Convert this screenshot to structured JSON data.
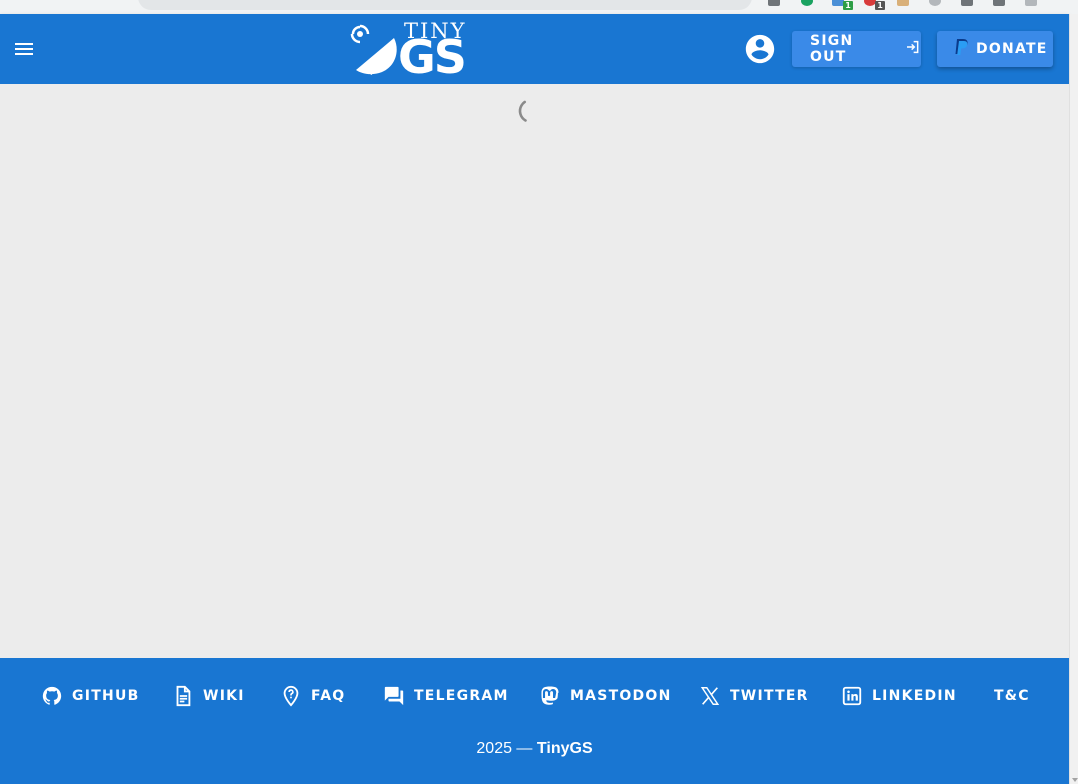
{
  "app": {
    "logo_small": "TINY",
    "logo_large": "GS"
  },
  "header": {
    "menu_icon": "menu-icon",
    "account_icon": "account-circle-icon",
    "sign_out_label": "SIGN OUT",
    "sign_out_icon": "sign-out-icon",
    "donate_label": "DONATE",
    "donate_icon": "paypal-icon"
  },
  "main": {
    "loading_icon": "loading-spinner-icon"
  },
  "footer": {
    "links": [
      {
        "label": "GITHUB",
        "icon": "github-icon"
      },
      {
        "label": "WIKI",
        "icon": "document-icon"
      },
      {
        "label": "FAQ",
        "icon": "help-marker-icon"
      },
      {
        "label": "TELEGRAM",
        "icon": "chat-icon"
      },
      {
        "label": "MASTODON",
        "icon": "mastodon-icon"
      },
      {
        "label": "TWITTER",
        "icon": "x-twitter-icon"
      },
      {
        "label": "LINKEDIN",
        "icon": "linkedin-icon"
      },
      {
        "label": "T&C",
        "icon": ""
      }
    ],
    "copyright_prefix": "2025 —",
    "copyright_brand": "TinyGS"
  },
  "browser": {
    "extension_badges": [
      "1",
      "1"
    ]
  },
  "colors": {
    "primary": "#1976d2",
    "button": "#3a8ae8",
    "background": "#ececec",
    "text_on_primary": "#ffffff"
  }
}
